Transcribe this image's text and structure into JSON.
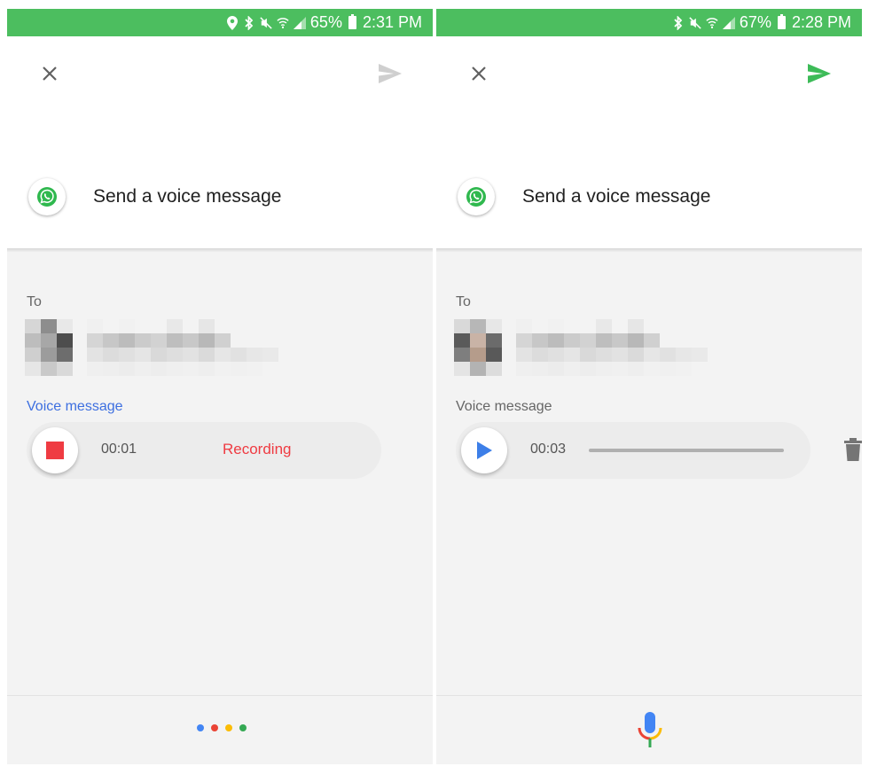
{
  "colors": {
    "status_green": "#4cbe5f",
    "send_active": "#3dbb58",
    "send_inactive": "#cfcfcf",
    "whatsapp_green": "#2fb84e",
    "record_red": "#ef3b42",
    "link_blue": "#3d6fe0",
    "play_blue": "#3d7fe8",
    "google_blue": "#4285f4",
    "google_red": "#ea4335",
    "google_yellow": "#fbbc05",
    "google_green": "#34a853"
  },
  "left": {
    "status": {
      "battery": "65%",
      "time": "2:31 PM",
      "icons": [
        "location-icon",
        "bluetooth-icon",
        "mute-icon",
        "wifi-icon",
        "signal-icon",
        "battery-icon"
      ]
    },
    "title": "Send a voice message",
    "to_label": "To",
    "voice_label": "Voice message",
    "timer": "00:01",
    "status_text": "Recording",
    "send_state": "disabled"
  },
  "right": {
    "status": {
      "battery": "67%",
      "time": "2:28 PM",
      "icons": [
        "bluetooth-icon",
        "mute-icon",
        "wifi-icon",
        "signal-icon",
        "battery-icon"
      ]
    },
    "title": "Send a voice message",
    "to_label": "To",
    "voice_label": "Voice message",
    "timer": "00:03",
    "send_state": "enabled",
    "playback_progress": 0.0
  }
}
